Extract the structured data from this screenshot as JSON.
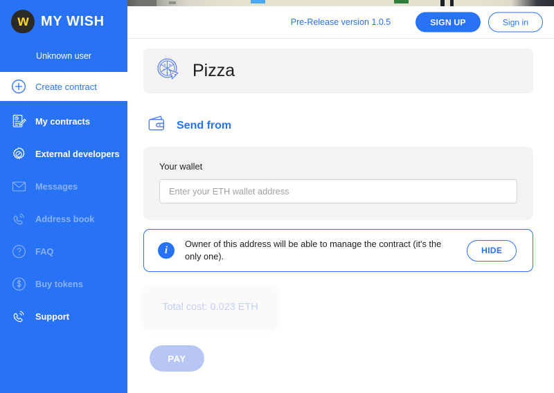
{
  "colors": {
    "brand_blue": "#2772f5",
    "sidebar_bg": "#2772f5",
    "card_gray": "#f3f3f3",
    "logo_yellow": "#ffd42a",
    "disabled_button": "#b8c6f5",
    "cost_text": "#c3d0f5"
  },
  "sidebar": {
    "brand_name": "MY WISH",
    "brand_logo_letter": "w",
    "user": "Unknown user",
    "items": [
      {
        "label": "Create contract",
        "icon": "plus-circle-icon",
        "state": "active-light"
      },
      {
        "label": "My contracts",
        "icon": "document-pencil-icon",
        "state": "enabled"
      },
      {
        "label": "External developers",
        "icon": "gear-icon",
        "state": "enabled"
      },
      {
        "label": "Messages",
        "icon": "envelope-icon",
        "state": "muted"
      },
      {
        "label": "Address book",
        "icon": "phone-icon",
        "state": "muted"
      },
      {
        "label": "FAQ",
        "icon": "question-circle-icon",
        "state": "muted"
      },
      {
        "label": "Buy tokens",
        "icon": "dollar-circle-icon",
        "state": "muted"
      },
      {
        "label": "Support",
        "icon": "phone-icon",
        "state": "enabled"
      }
    ]
  },
  "topbar": {
    "version": "Pre-Release version 1.0.5",
    "sign_up_label": "SIGN UP",
    "sign_in_label": "Sign in"
  },
  "main": {
    "contract_title": "Pizza",
    "contract_icon": "pizza-icon",
    "section": {
      "title": "Send from",
      "icon": "wallet-icon"
    },
    "wallet": {
      "label": "Your wallet",
      "value": "",
      "placeholder": "Enter your ETH wallet address"
    },
    "notice": {
      "icon": "info-icon",
      "text": "Owner of this address will be able to manage the contract (it's the only one).",
      "hide_label": "HIDE"
    },
    "cost": {
      "text": "Total cost: 0.023 ETH"
    },
    "pay_label": "PAY"
  }
}
